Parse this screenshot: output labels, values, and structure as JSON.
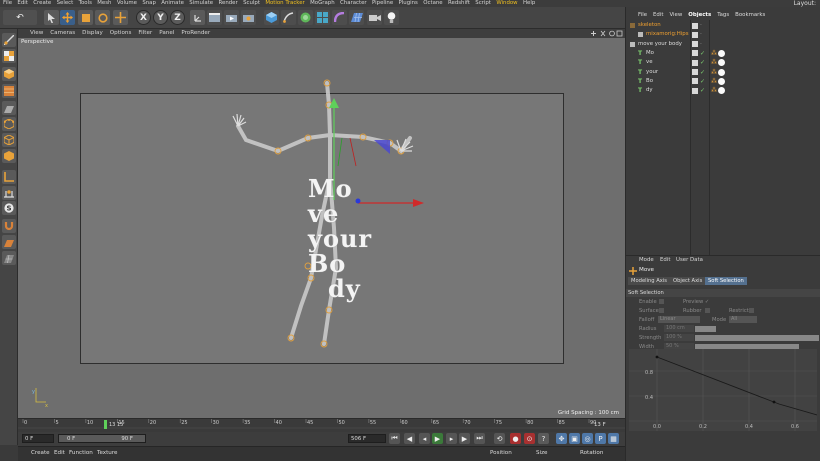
{
  "menubar": {
    "items": [
      "File",
      "Edit",
      "Create",
      "Select",
      "Tools",
      "Mesh",
      "Volume",
      "Snap",
      "Animate",
      "Simulate",
      "Render",
      "Sculpt",
      "Motion Tracker",
      "MoGraph",
      "Character",
      "Pipeline",
      "Plugins",
      "Octane",
      "Redshift",
      "Script",
      "Window",
      "Help"
    ],
    "layout_label": "Layout:"
  },
  "toolbar": {
    "undo": "↶",
    "x": "X",
    "y": "Y",
    "z": "Z"
  },
  "viewport": {
    "menu": [
      "View",
      "Cameras",
      "Display",
      "Options",
      "Filter",
      "Panel",
      "ProRender"
    ],
    "label": "Perspective",
    "grid_spacing": "Grid Spacing : 100 cm",
    "text_lines": [
      "Mo",
      "ve",
      "your",
      "Bo",
      "dy"
    ],
    "axis_x": "x",
    "axis_y": "y"
  },
  "timeline": {
    "ticks": [
      "0",
      "5",
      "10",
      "15",
      "20",
      "25",
      "30",
      "35",
      "40",
      "45",
      "50",
      "55",
      "60",
      "65",
      "70",
      "75",
      "80",
      "85",
      "90"
    ],
    "playhead_label": "13 15",
    "frame_end": "13 F"
  },
  "transport": {
    "start_field": "0 F",
    "range_start": "0 F",
    "range_end": "90 F",
    "end_field": "506 F"
  },
  "bottombar": {
    "left": [
      "Create",
      "Edit",
      "Function",
      "Texture"
    ],
    "right": [
      "Position",
      "Size",
      "Rotation"
    ]
  },
  "objects": {
    "tabs": [
      "File",
      "Edit",
      "View",
      "Objects",
      "Tags",
      "Bookmarks"
    ],
    "active_tab": "Objects",
    "rows": [
      {
        "name": "skeleton",
        "indent": 0,
        "color": "#f0a030",
        "tick": false,
        "dot": false
      },
      {
        "name": "mixamorig:Hips",
        "indent": 1,
        "color": "#f0a030",
        "tick": false,
        "dot": false
      },
      {
        "name": "move your body",
        "indent": 0,
        "color": "#dddddd",
        "tick": false,
        "dot": false
      },
      {
        "name": "Mo",
        "indent": 1,
        "color": "#dddddd",
        "tick": true,
        "dot": true
      },
      {
        "name": "ve",
        "indent": 1,
        "color": "#dddddd",
        "tick": true,
        "dot": true
      },
      {
        "name": "your",
        "indent": 1,
        "color": "#dddddd",
        "tick": true,
        "dot": true
      },
      {
        "name": "Bo",
        "indent": 1,
        "color": "#dddddd",
        "tick": true,
        "dot": true
      },
      {
        "name": "dy",
        "indent": 1,
        "color": "#dddddd",
        "tick": true,
        "dot": true
      }
    ]
  },
  "attributes": {
    "tabs": [
      "Mode",
      "Edit",
      "User Data"
    ],
    "title": "Move",
    "sub_tabs": [
      "Modeling Axis",
      "Object Axis",
      "Soft Selection"
    ],
    "active_sub_tab": "Soft Selection",
    "section": "Soft Selection",
    "enable": "Enable",
    "preview": "Preview ✓",
    "surface": "Surface",
    "rubber": "Rubber",
    "restrict": "Restrict",
    "falloff": "Falloff",
    "falloff_value": "Linear",
    "mode": "Mode",
    "mode_value": "All",
    "radius": "Radius",
    "radius_value": "100 cm",
    "strength": "Strength",
    "strength_value": "100 %",
    "width": "Width",
    "width_value": "50 %",
    "curve_y": [
      "0.8",
      "0.4"
    ],
    "curve_x": [
      "0.0",
      "0.2",
      "0.4",
      "0.6"
    ]
  }
}
